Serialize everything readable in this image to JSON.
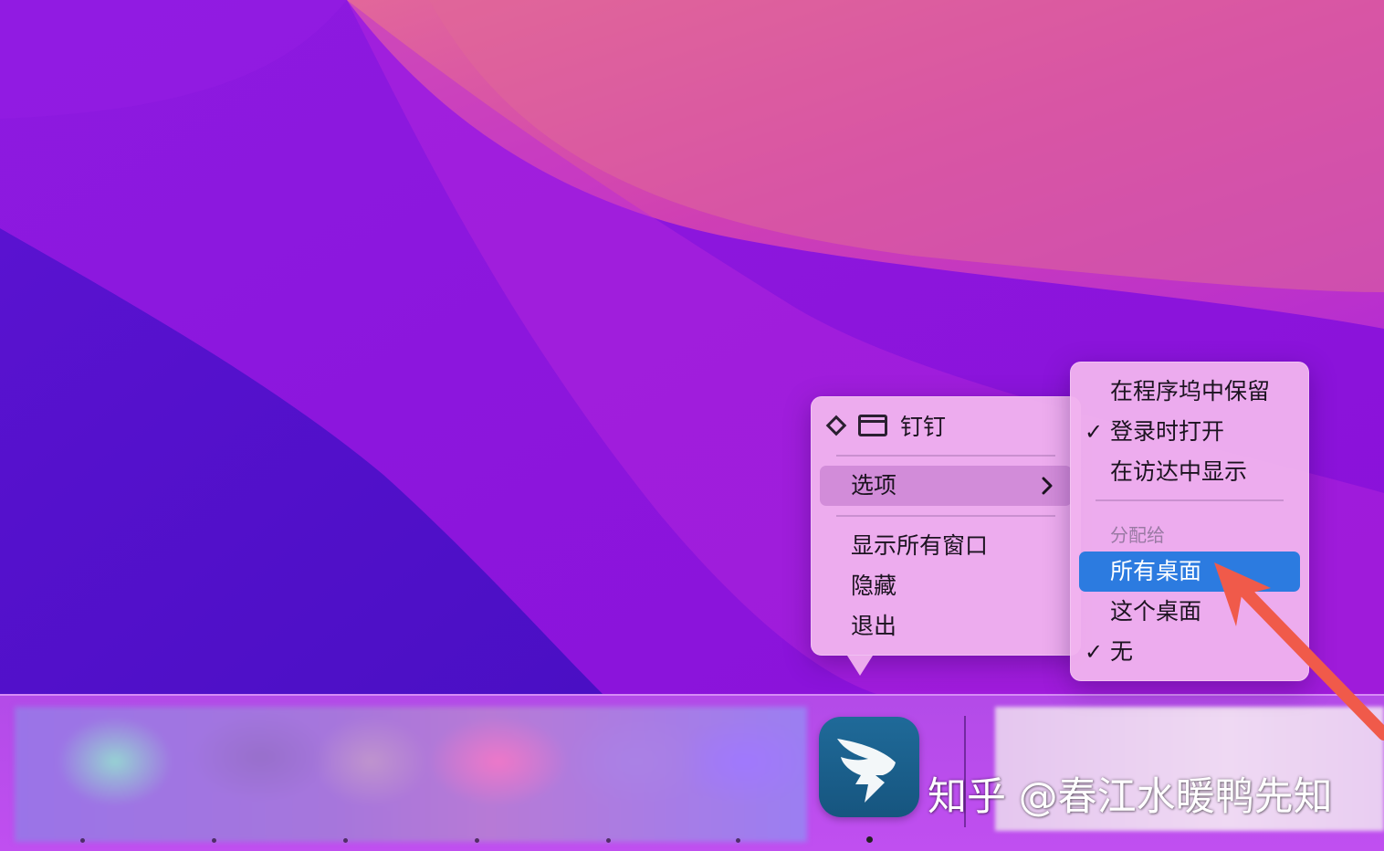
{
  "app": {
    "name": "钉钉",
    "icon": "dingtalk-icon"
  },
  "main_menu": {
    "options_label": "选项",
    "items": [
      "显示所有窗口",
      "隐藏",
      "退出"
    ]
  },
  "options_menu": {
    "items_top": [
      {
        "label": "在程序坞中保留",
        "checked": false
      },
      {
        "label": "登录时打开",
        "checked": true
      },
      {
        "label": "在访达中显示",
        "checked": false
      }
    ],
    "assign_header": "分配给",
    "assign_items": [
      {
        "label": "所有桌面",
        "checked": false,
        "highlighted": true
      },
      {
        "label": "这个桌面",
        "checked": false
      },
      {
        "label": "无",
        "checked": true
      }
    ],
    "check_glyph": "✓"
  },
  "watermark": "知乎 @春江水暖鸭先知",
  "colors": {
    "highlight": "#2c7be0",
    "menu_bg": "#f0b2ee",
    "arrow": "#f05a4a"
  }
}
